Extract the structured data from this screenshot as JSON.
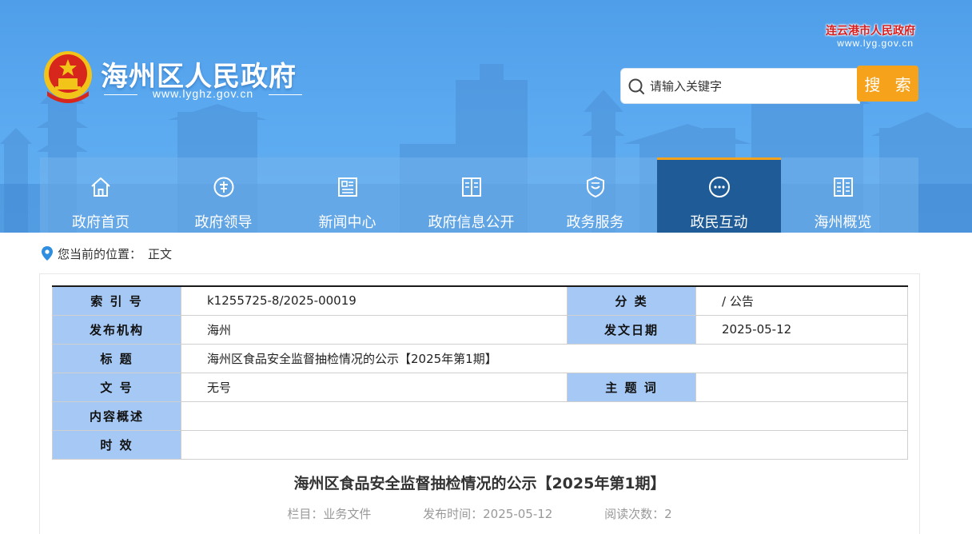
{
  "header": {
    "site_title": "海州区人民政府",
    "site_url": "www.lyghz.gov.cn",
    "city_title": "连云港市人民政府",
    "city_url": "www.lyg.gov.cn",
    "search_placeholder": "请输入关键字",
    "search_button": "搜 索"
  },
  "nav": {
    "items": [
      {
        "label": "政府首页",
        "icon": "home-icon",
        "active": false
      },
      {
        "label": "政府领导",
        "icon": "leader-icon",
        "active": false
      },
      {
        "label": "新闻中心",
        "icon": "news-icon",
        "active": false
      },
      {
        "label": "政府信息公开",
        "icon": "book-icon",
        "active": false
      },
      {
        "label": "政务服务",
        "icon": "shield-icon",
        "active": false
      },
      {
        "label": "政民互动",
        "icon": "chat-icon",
        "active": true
      },
      {
        "label": "海州概览",
        "icon": "book-icon",
        "active": false
      }
    ]
  },
  "breadcrumb": {
    "label": "您当前的位置：",
    "current": "正文"
  },
  "meta": {
    "index_label": "索 引 号",
    "index_value": "k1255725-8/2025-00019",
    "category_label": "分 类",
    "category_value": "/ 公告",
    "publisher_label": "发布机构",
    "publisher_value": "海州",
    "date_label": "发文日期",
    "date_value": "2025-05-12",
    "title_label": "标 题",
    "title_value": "海州区食品安全监督抽检情况的公示【2025年第1期】",
    "docno_label": "文 号",
    "docno_value": "无号",
    "keywords_label": "主 题 词",
    "keywords_value": "",
    "summary_label": "内容概述",
    "summary_value": "",
    "validity_label": "时 效",
    "validity_value": ""
  },
  "article": {
    "title": "海州区食品安全监督抽检情况的公示【2025年第1期】",
    "column": "栏目：业务文件",
    "published": "发布时间：2025-05-12",
    "views": "阅读次数：2"
  },
  "colors": {
    "header_blue": "#5aa8ef",
    "nav_active": "#1f5c97",
    "accent_orange": "#f7a21b",
    "table_key_bg": "#a6c8f5",
    "city_title_red": "#d81e1e"
  }
}
